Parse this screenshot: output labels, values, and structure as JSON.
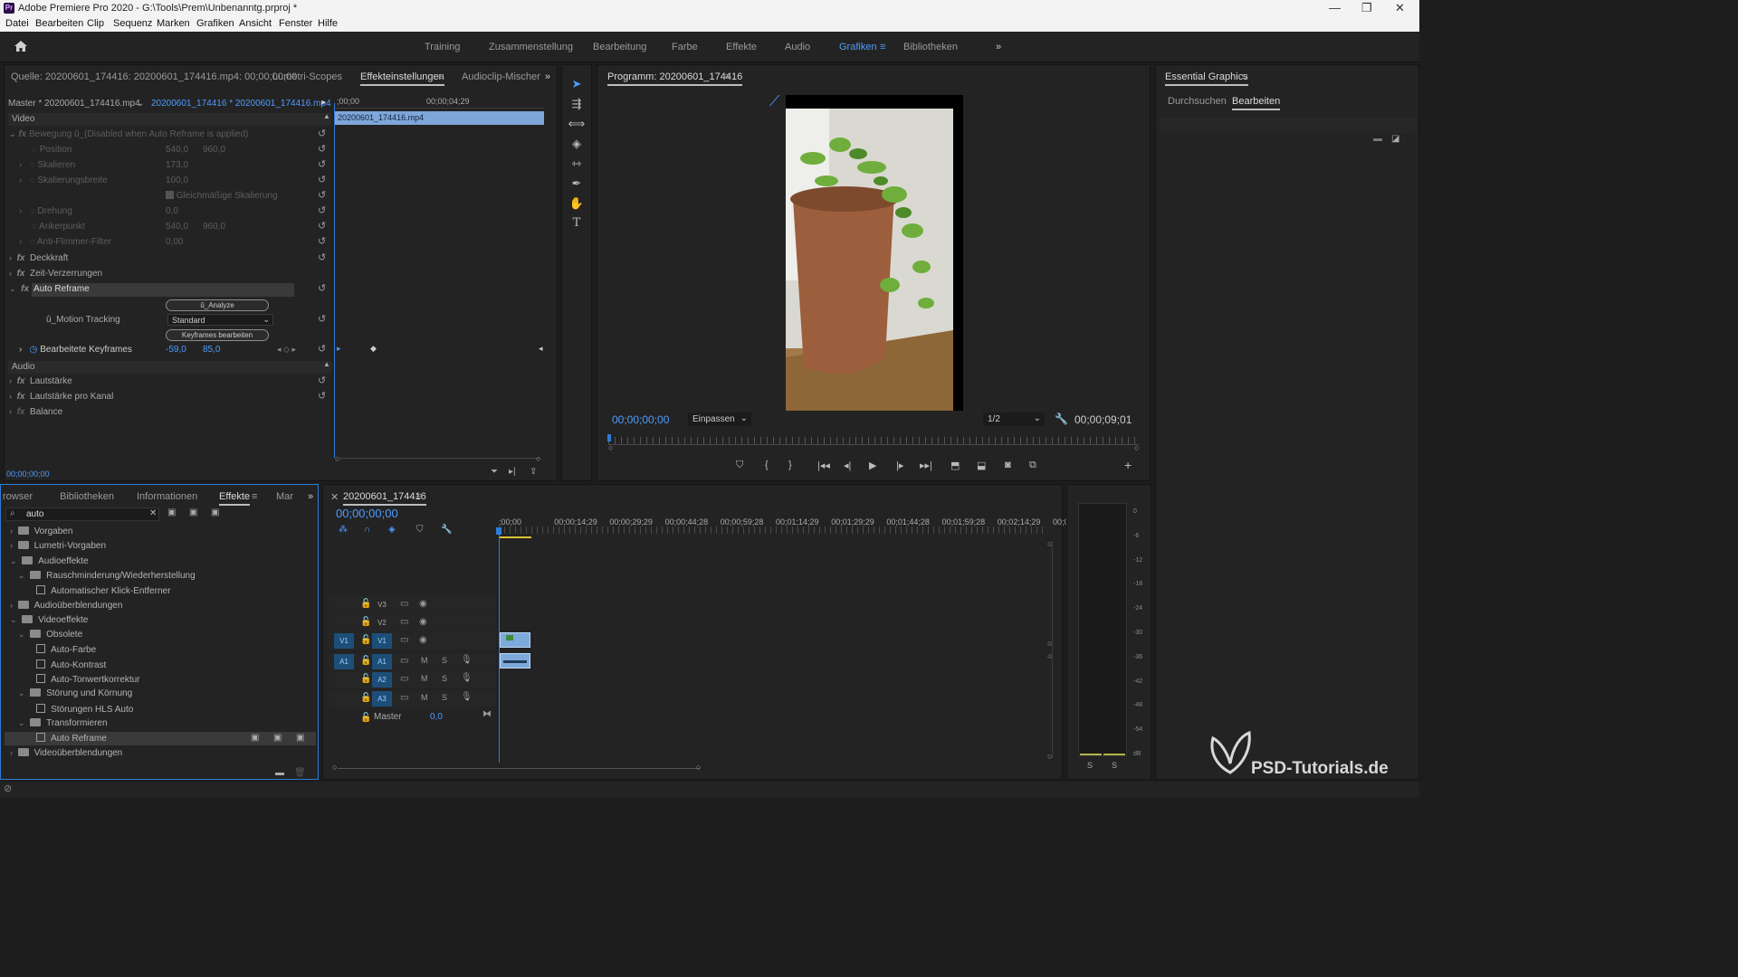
{
  "window": {
    "app_icon": "Pr",
    "title": "Adobe Premiere Pro 2020 - G:\\Tools\\Prem\\Unbenanntg.prproj *",
    "minimize": "—",
    "restore": "❐",
    "close": "✕"
  },
  "menu": [
    "Datei",
    "Bearbeiten",
    "Clip",
    "Sequenz",
    "Marken",
    "Grafiken",
    "Ansicht",
    "Fenster",
    "Hilfe"
  ],
  "workspaces": [
    "Training",
    "Zusammenstellung",
    "Bearbeitung",
    "Farbe",
    "Effekte",
    "Audio",
    "Grafiken",
    "Bibliotheken"
  ],
  "active_workspace": "Grafiken",
  "source_panel": {
    "tabs": [
      "Quelle: 20200601_174416: 20200601_174416.mp4: 00;00;00;00",
      "Lumetri-Scopes",
      "Effekteinstellungen",
      "Audioclip-Mischer"
    ],
    "master_label": "Master * 20200601_174416.mp4",
    "clip_label": "20200601_174416 * 20200601_174416.mp4",
    "video_header": "Video",
    "audio_header": "Audio",
    "timeline_start": ";00;00",
    "timeline_end": "00;00;04;29",
    "clip_bar": "20200601_174416.mp4",
    "bottom_timecode": "00;00;00;00",
    "bewegung": "Bewegung  û_(Disabled when Auto Reframe is applied)",
    "params": [
      {
        "label": "Position",
        "v1": "540,0",
        "v2": "960,0"
      },
      {
        "label": "Skalieren",
        "v1": "173,0",
        "v2": ""
      },
      {
        "label": "Skalierungsbreite",
        "v1": "100,0",
        "v2": ""
      },
      {
        "label": "Gleichmäßige Skalierung",
        "v1": "",
        "v2": ""
      },
      {
        "label": "Drehung",
        "v1": "0,0",
        "v2": ""
      },
      {
        "label": "Ankerpunkt",
        "v1": "540,0",
        "v2": "960,0"
      },
      {
        "label": "Anti-Flimmer-Filter",
        "v1": "0,00",
        "v2": ""
      }
    ],
    "deckkraft": "Deckkraft",
    "zeit": "Zeit-Verzerrungen",
    "auto_reframe": "Auto Reframe",
    "analyze_btn": "û_Analyze",
    "motion_tracking_label": "û_Motion Tracking",
    "motion_tracking_value": "Standard",
    "keyframes_btn": "Keyframes bearbeiten",
    "keyframes_label": "Bearbeitete Keyframes",
    "kf_v1": "-59,0",
    "kf_v2": "85,0",
    "lautstaerke": "Lautstärke",
    "lautstaerke_kanal": "Lautstärke pro Kanal",
    "balance": "Balance"
  },
  "program_panel": {
    "title": "Programm: 20200601_174416",
    "timecode": "00;00;00;00",
    "fit": "Einpassen",
    "resolution": "1/2",
    "duration": "00;00;09;01"
  },
  "essential_graphics": {
    "title": "Essential Graphics",
    "tabs": [
      "Durchsuchen",
      "Bearbeiten"
    ]
  },
  "effects_panel": {
    "tabs": [
      "rowser",
      "Bibliotheken",
      "Informationen",
      "Effekte",
      "Mar"
    ],
    "search_value": "auto",
    "tree": [
      {
        "label": "Vorgaben",
        "level": 0,
        "type": "folder",
        "open": false
      },
      {
        "label": "Lumetri-Vorgaben",
        "level": 0,
        "type": "folder",
        "open": false
      },
      {
        "label": "Audioeffekte",
        "level": 0,
        "type": "folder",
        "open": true
      },
      {
        "label": "Rauschminderung/Wiederherstellung",
        "level": 1,
        "type": "folder",
        "open": true
      },
      {
        "label": "Automatischer Klick-Entferner",
        "level": 2,
        "type": "preset"
      },
      {
        "label": "Audioüberblendungen",
        "level": 0,
        "type": "folder",
        "open": false
      },
      {
        "label": "Videoeffekte",
        "level": 0,
        "type": "folder",
        "open": true
      },
      {
        "label": "Obsolete",
        "level": 1,
        "type": "folder",
        "open": true
      },
      {
        "label": "Auto-Farbe",
        "level": 2,
        "type": "preset"
      },
      {
        "label": "Auto-Kontrast",
        "level": 2,
        "type": "preset"
      },
      {
        "label": "Auto-Tonwertkorrektur",
        "level": 2,
        "type": "preset"
      },
      {
        "label": "Störung und Körnung",
        "level": 1,
        "type": "folder",
        "open": true
      },
      {
        "label": "Störungen HLS Auto",
        "level": 2,
        "type": "preset"
      },
      {
        "label": "Transformieren",
        "level": 1,
        "type": "folder",
        "open": true
      },
      {
        "label": "Auto Reframe",
        "level": 2,
        "type": "preset",
        "selected": true
      },
      {
        "label": "Videoüberblendungen",
        "level": 0,
        "type": "folder",
        "open": false
      }
    ]
  },
  "timeline_panel": {
    "tab": "20200601_174416",
    "timecode": "00;00;00;00",
    "ruler": [
      ";00;00",
      "00;00;14;29",
      "00;00;29;29",
      "00;00;44;28",
      "00;00;59;28",
      "00;01;14;29",
      "00;01;29;29",
      "00;01;44;28",
      "00;01;59;28",
      "00;02;14;29",
      "00;0"
    ],
    "video_tracks": [
      "V3",
      "V2",
      "V1"
    ],
    "audio_tracks": [
      "A1",
      "A2",
      "A3"
    ],
    "source_v": "V1",
    "source_a": "A1",
    "m": "M",
    "s": "S",
    "master_label": "Master",
    "master_value": "0,0"
  },
  "audio_meter": {
    "scale": [
      "0",
      "-6",
      "-12",
      "-18",
      "-24",
      "-30",
      "-36",
      "-42",
      "-48",
      "-54",
      "dB"
    ],
    "solo": [
      "S",
      "S"
    ]
  },
  "watermark": "PSD-Tutorials.de"
}
